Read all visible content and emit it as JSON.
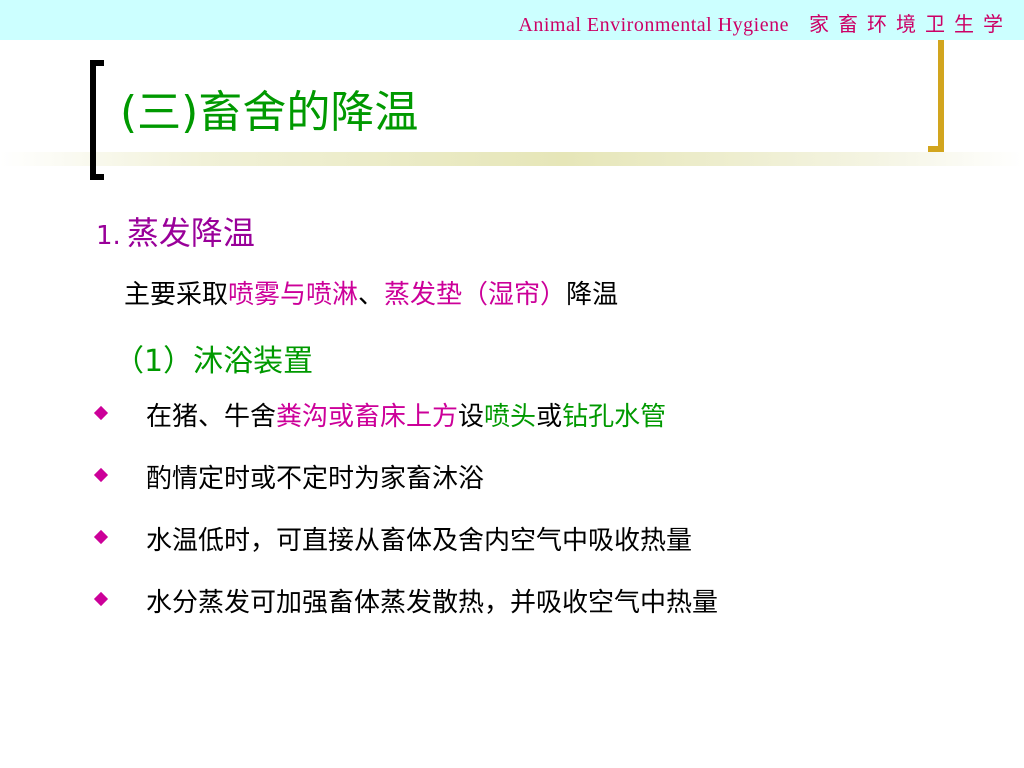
{
  "header": {
    "course_en": "Animal  Environmental  Hygiene",
    "course_cn": "家畜环境卫生学"
  },
  "title": "(三)畜舍的降温",
  "section": {
    "number": "1.",
    "heading": "蒸发降温",
    "intro": {
      "p1": "主要采取",
      "h1": "喷雾与喷淋",
      "p2": "、",
      "h2": "蒸发垫（湿帘）",
      "p3": "降温"
    }
  },
  "subsection": {
    "heading": "（1）沐浴装置"
  },
  "bullets": [
    {
      "p1": "在猪、牛舍",
      "h1": "粪沟或畜床上方",
      "p2": "设",
      "h2": "喷头",
      "p3": "或",
      "h3": "钻孔水管"
    },
    {
      "text": "酌情定时或不定时为家畜沐浴"
    },
    {
      "text": "水温低时，可直接从畜体及舍内空气中吸收热量"
    },
    {
      "text": "水分蒸发可加强畜体蒸发散热，并吸收空气中热量"
    }
  ],
  "colors": {
    "title_green": "#009900",
    "heading_purple": "#990099",
    "highlight_magenta": "#cc0099",
    "header_band": "#ccffff",
    "bracket_gold": "#d2a51e"
  }
}
